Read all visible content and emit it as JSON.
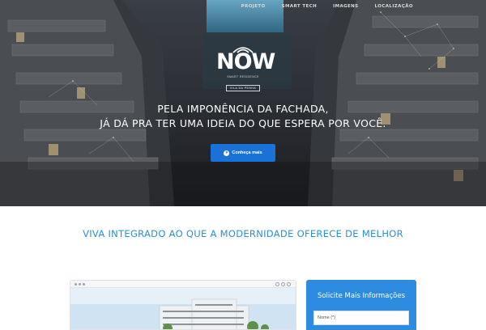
{
  "nav": {
    "items": [
      "PROJETO",
      "SMART TECH",
      "IMAGENS",
      "LOCALIZAÇÃO"
    ]
  },
  "logo": {
    "word": "NOW",
    "tagline": "SMART RESIDENCE",
    "badge": "VILA DA PENHA"
  },
  "hero": {
    "line1": "PELA IMPONÊNCIA DA FACHADA,",
    "line2": "JÁ DÁ PRA TER UMA IDEIA DO QUE ESPERA POR VOCÊ.",
    "cta_label": "Conheça mais",
    "cta_icon": "chevron-down-icon"
  },
  "section": {
    "title": "VIVA INTEGRADO AO QUE A MODERNIDADE OFERECE DE MELHOR"
  },
  "form": {
    "title": "Solicite Mais Informações",
    "name_placeholder": "Nome (*)"
  },
  "colors": {
    "accent": "#1b72d6",
    "title_blue": "#2b8fd6",
    "form_blue": "#2d8be0"
  }
}
